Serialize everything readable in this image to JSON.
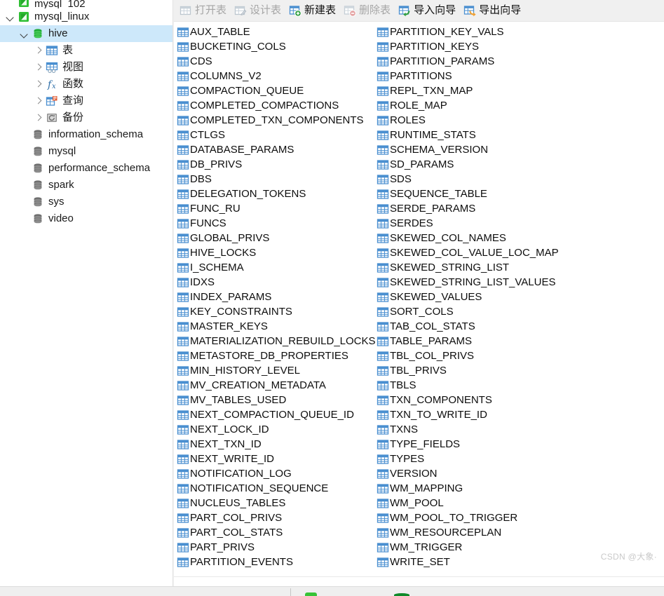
{
  "app": {
    "watermark": "CSDN @大象·"
  },
  "sidebar": {
    "items": [
      {
        "label": "mysql_102",
        "icon": "connection-icon",
        "indent": 0,
        "twisty": "none",
        "selected": false,
        "partial": true
      },
      {
        "label": "mysql_linux",
        "icon": "connection-icon",
        "indent": 0,
        "twisty": "expanded",
        "selected": false
      },
      {
        "label": "hive",
        "icon": "database-icon",
        "indent": 1,
        "twisty": "expanded",
        "selected": true
      },
      {
        "label": "表",
        "icon": "table-icon",
        "indent": 2,
        "twisty": "collapsed",
        "selected": false
      },
      {
        "label": "视图",
        "icon": "view-icon",
        "indent": 2,
        "twisty": "collapsed",
        "selected": false
      },
      {
        "label": "函数",
        "icon": "function-icon",
        "indent": 2,
        "twisty": "collapsed",
        "selected": false
      },
      {
        "label": "查询",
        "icon": "query-icon",
        "indent": 2,
        "twisty": "collapsed",
        "selected": false
      },
      {
        "label": "备份",
        "icon": "backup-icon",
        "indent": 2,
        "twisty": "collapsed",
        "selected": false
      },
      {
        "label": "information_schema",
        "icon": "database-icon",
        "indent": 1,
        "twisty": "none",
        "selected": false
      },
      {
        "label": "mysql",
        "icon": "database-icon",
        "indent": 1,
        "twisty": "none",
        "selected": false
      },
      {
        "label": "performance_schema",
        "icon": "database-icon",
        "indent": 1,
        "twisty": "none",
        "selected": false
      },
      {
        "label": "spark",
        "icon": "database-icon",
        "indent": 1,
        "twisty": "none",
        "selected": false
      },
      {
        "label": "sys",
        "icon": "database-icon",
        "indent": 1,
        "twisty": "none",
        "selected": false
      },
      {
        "label": "video",
        "icon": "database-icon",
        "indent": 1,
        "twisty": "none",
        "selected": false
      }
    ]
  },
  "toolbar": {
    "buttons": [
      {
        "label": "打开表",
        "icon": "open-table-icon",
        "enabled": false
      },
      {
        "label": "设计表",
        "icon": "design-table-icon",
        "enabled": false
      },
      {
        "label": "新建表",
        "icon": "new-table-icon",
        "enabled": true
      },
      {
        "label": "删除表",
        "icon": "delete-table-icon",
        "enabled": false
      },
      {
        "label": "导入向导",
        "icon": "import-wizard-icon",
        "enabled": true
      },
      {
        "label": "导出向导",
        "icon": "export-wizard-icon",
        "enabled": true
      }
    ]
  },
  "table_list": {
    "icon": "table-icon",
    "column_left": [
      "AUX_TABLE",
      "BUCKETING_COLS",
      "CDS",
      "COLUMNS_V2",
      "COMPACTION_QUEUE",
      "COMPLETED_COMPACTIONS",
      "COMPLETED_TXN_COMPONENTS",
      "CTLGS",
      "DATABASE_PARAMS",
      "DB_PRIVS",
      "DBS",
      "DELEGATION_TOKENS",
      "FUNC_RU",
      "FUNCS",
      "GLOBAL_PRIVS",
      "HIVE_LOCKS",
      "I_SCHEMA",
      "IDXS",
      "INDEX_PARAMS",
      "KEY_CONSTRAINTS",
      "MASTER_KEYS",
      "MATERIALIZATION_REBUILD_LOCKS",
      "METASTORE_DB_PROPERTIES",
      "MIN_HISTORY_LEVEL",
      "MV_CREATION_METADATA",
      "MV_TABLES_USED",
      "NEXT_COMPACTION_QUEUE_ID",
      "NEXT_LOCK_ID",
      "NEXT_TXN_ID",
      "NEXT_WRITE_ID",
      "NOTIFICATION_LOG",
      "NOTIFICATION_SEQUENCE",
      "NUCLEUS_TABLES",
      "PART_COL_PRIVS",
      "PART_COL_STATS",
      "PART_PRIVS",
      "PARTITION_EVENTS"
    ],
    "column_right": [
      "PARTITION_KEY_VALS",
      "PARTITION_KEYS",
      "PARTITION_PARAMS",
      "PARTITIONS",
      "REPL_TXN_MAP",
      "ROLE_MAP",
      "ROLES",
      "RUNTIME_STATS",
      "SCHEMA_VERSION",
      "SD_PARAMS",
      "SDS",
      "SEQUENCE_TABLE",
      "SERDE_PARAMS",
      "SERDES",
      "SKEWED_COL_NAMES",
      "SKEWED_COL_VALUE_LOC_MAP",
      "SKEWED_STRING_LIST",
      "SKEWED_STRING_LIST_VALUES",
      "SKEWED_VALUES",
      "SORT_COLS",
      "TAB_COL_STATS",
      "TABLE_PARAMS",
      "TBL_COL_PRIVS",
      "TBL_PRIVS",
      "TBLS",
      "TXN_COMPONENTS",
      "TXN_TO_WRITE_ID",
      "TXNS",
      "TYPE_FIELDS",
      "TYPES",
      "VERSION",
      "WM_MAPPING",
      "WM_POOL",
      "WM_POOL_TO_TRIGGER",
      "WM_RESOURCEPLAN",
      "WM_TRIGGER",
      "WRITE_SET"
    ]
  },
  "colors": {
    "selection": "#cde8fa",
    "table_icon": "#4a8fd0",
    "connection_green": "#2eb82e",
    "db_gray": "#6d6d6d",
    "toolbar_bg": "#f0f0f0"
  }
}
